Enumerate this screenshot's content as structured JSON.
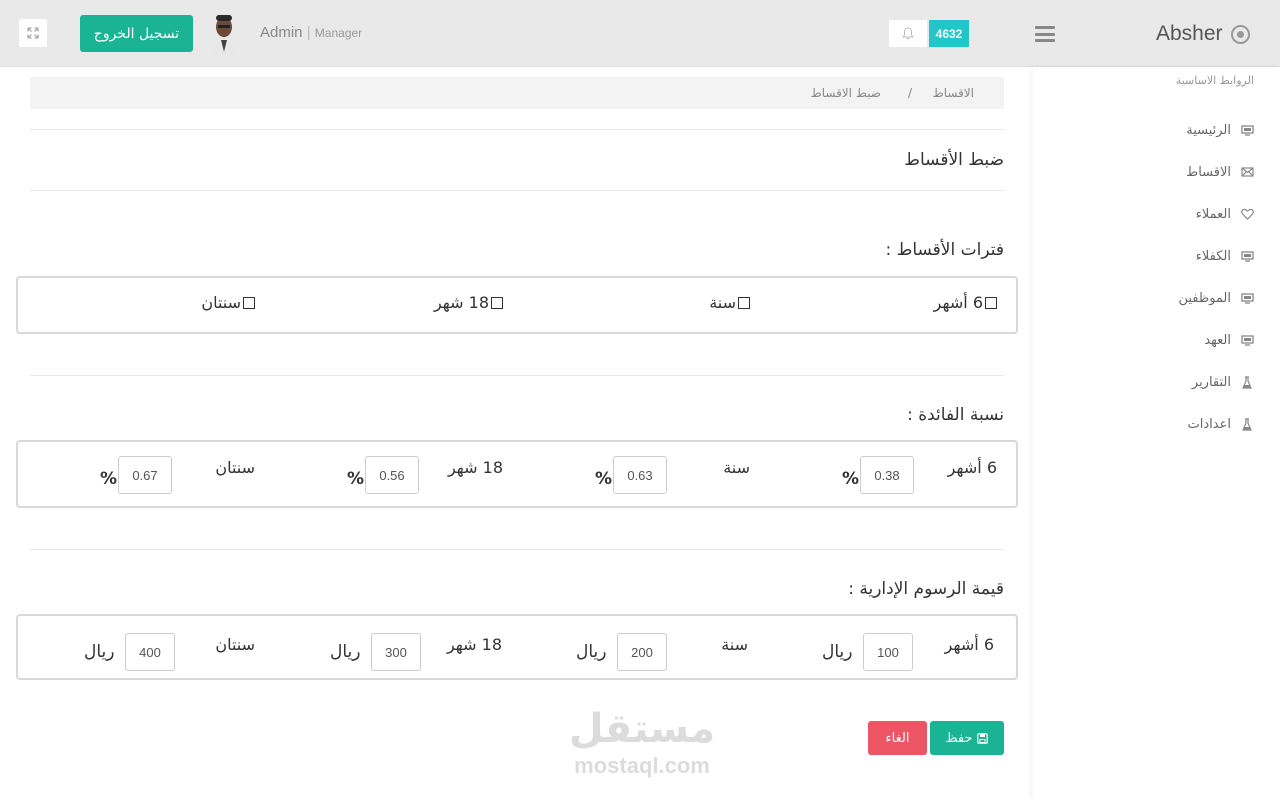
{
  "header": {
    "logout_label": "تسجيل الخروج",
    "user_name": "Admin",
    "user_role": "Manager",
    "notification_count": "4632",
    "brand": "Absher"
  },
  "sidebar": {
    "title": "الروابط الاساسية",
    "items": [
      {
        "label": "الرئيسية",
        "icon": "monitor-icon"
      },
      {
        "label": "الاقساط",
        "icon": "envelope-icon"
      },
      {
        "label": "العملاء",
        "icon": "heart-icon"
      },
      {
        "label": "الكفلاء",
        "icon": "monitor-icon"
      },
      {
        "label": "الموظفين",
        "icon": "monitor-icon"
      },
      {
        "label": "العهد",
        "icon": "monitor-icon"
      },
      {
        "label": "التقارير",
        "icon": "flask-icon"
      },
      {
        "label": "اعدادات",
        "icon": "flask-icon"
      }
    ]
  },
  "breadcrumb": {
    "parent": "الاقساط",
    "separator": "/",
    "current": "ضبط الاقساط"
  },
  "page_title": "ضبط الأقساط",
  "periods": {
    "title": "فترات الأقساط :",
    "options": [
      "6 أشهر",
      "سنة",
      "18 شهر",
      "سنتان"
    ]
  },
  "interest": {
    "title": "نسبة الفائدة :",
    "unit": "%",
    "rows": [
      {
        "label": "6 أشهر",
        "value": "0.38"
      },
      {
        "label": "سنة",
        "value": "0.63"
      },
      {
        "label": "18 شهر",
        "value": "0.56"
      },
      {
        "label": "سنتان",
        "value": "0.67"
      }
    ]
  },
  "fees": {
    "title": "قيمة الرسوم الإدارية :",
    "unit": "ريال",
    "rows": [
      {
        "label": "6 أشهر",
        "value": "100"
      },
      {
        "label": "سنة",
        "value": "200"
      },
      {
        "label": "18 شهر",
        "value": "300"
      },
      {
        "label": "سنتان",
        "value": "400"
      }
    ]
  },
  "actions": {
    "save_label": "حفظ",
    "cancel_label": "الغاء"
  },
  "watermark": {
    "arabic": "مستقل",
    "latin": "mostaql.com"
  },
  "colors": {
    "primary": "#1ab394",
    "danger": "#ed5565",
    "badge": "#23c6c8"
  }
}
